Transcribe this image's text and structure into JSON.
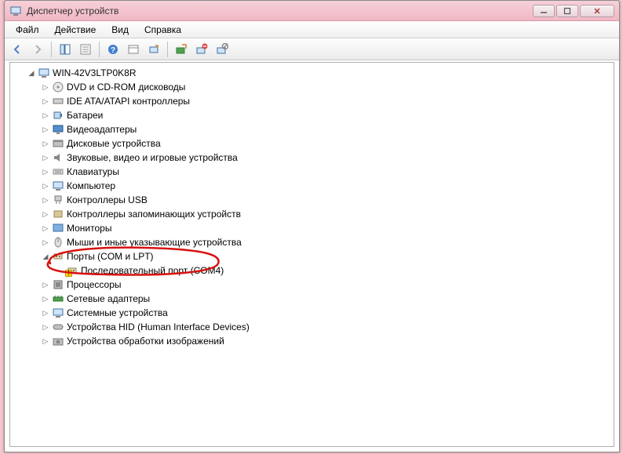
{
  "window": {
    "title": "Диспетчер устройств"
  },
  "menu": {
    "file": "Файл",
    "action": "Действие",
    "view": "Вид",
    "help": "Справка"
  },
  "tree": {
    "root": "WIN-42V3LTP0K8R",
    "items": [
      {
        "label": "DVD и CD-ROM дисководы",
        "icon": "💿"
      },
      {
        "label": "IDE ATA/ATAPI контроллеры",
        "icon": "📼"
      },
      {
        "label": "Батареи",
        "icon": "🔋"
      },
      {
        "label": "Видеоадаптеры",
        "icon": "🖥"
      },
      {
        "label": "Дисковые устройства",
        "icon": "💾"
      },
      {
        "label": "Звуковые, видео и игровые устройства",
        "icon": "🔊"
      },
      {
        "label": "Клавиатуры",
        "icon": "⌨"
      },
      {
        "label": "Компьютер",
        "icon": "🖳"
      },
      {
        "label": "Контроллеры USB",
        "icon": "🔌"
      },
      {
        "label": "Контроллеры запоминающих устройств",
        "icon": "📦"
      },
      {
        "label": "Мониторы",
        "icon": "🖵"
      },
      {
        "label": "Мыши и иные указывающие устройства",
        "icon": "🖱"
      }
    ],
    "ports": {
      "label": "Порты (COM и LPT)",
      "icon": "🔗",
      "child": {
        "label": "Последовательный порт (COM4)",
        "icon": "🔗"
      }
    },
    "items2": [
      {
        "label": "Процессоры",
        "icon": "▣"
      },
      {
        "label": "Сетевые адаптеры",
        "icon": "🖧"
      },
      {
        "label": "Системные устройства",
        "icon": "🖳"
      },
      {
        "label": "Устройства HID (Human Interface Devices)",
        "icon": "🎮"
      },
      {
        "label": "Устройства обработки изображений",
        "icon": "📷"
      }
    ]
  }
}
